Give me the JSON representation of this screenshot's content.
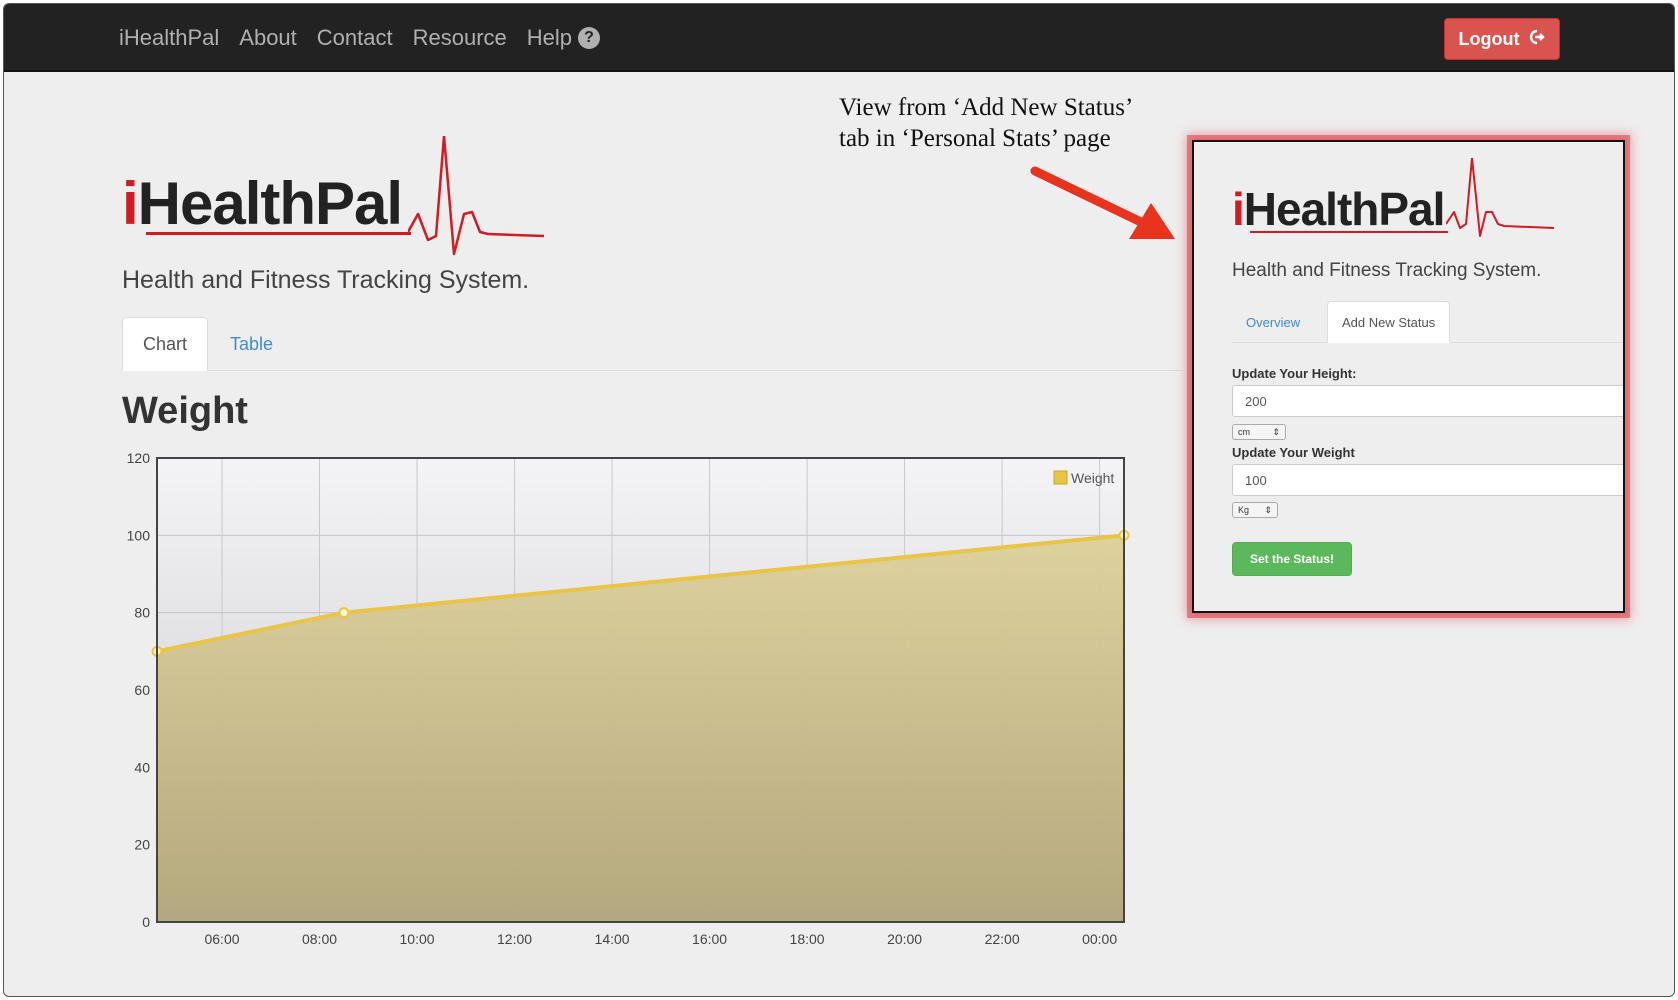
{
  "navbar": {
    "brand": "iHealthPal",
    "links": [
      "About",
      "Contact",
      "Resource",
      "Help"
    ],
    "help_icon": "question-circle-icon",
    "logout_label": "Logout",
    "logout_icon": "sign-out-icon",
    "logout_color": "#d9534f"
  },
  "logo": {
    "prefix": "i",
    "text": "HealthPal",
    "tagline": "Health and Fitness Tracking System.",
    "accent_color": "#d01c24"
  },
  "tabs": [
    {
      "label": "Chart",
      "active": true
    },
    {
      "label": "Table",
      "active": false
    }
  ],
  "section_title": "Weight",
  "chart_data": {
    "type": "area",
    "x": [
      "04:40",
      "08:30",
      "00:30"
    ],
    "values": [
      70,
      80,
      100
    ],
    "tick_labels_x": [
      "06:00",
      "08:00",
      "10:00",
      "12:00",
      "14:00",
      "16:00",
      "18:00",
      "20:00",
      "22:00",
      "00:00"
    ],
    "tick_labels_y": [
      "0",
      "20",
      "40",
      "60",
      "80",
      "100",
      "120"
    ],
    "ylim": [
      0,
      120
    ],
    "legend": "Weight",
    "legend_position": "top-right",
    "grid": true,
    "series_color": "#e8c547",
    "fill_color": "#cfc086"
  },
  "annotation": {
    "line1": "View from ‘Add New Status’",
    "line2": "tab in ‘Personal Stats’ page",
    "arrow_color": "#e8331f"
  },
  "inset": {
    "tabs": [
      {
        "label": "Overview",
        "active": false
      },
      {
        "label": "Add New Status",
        "active": true
      }
    ],
    "height_label": "Update Your Height:",
    "height_value": "200",
    "height_unit": "cm",
    "weight_label": "Update Your Weight",
    "weight_value": "100",
    "weight_unit": "Kg",
    "submit_label": "Set the Status!",
    "submit_color": "#5cb85c"
  }
}
